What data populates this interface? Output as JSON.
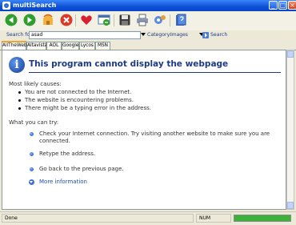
{
  "window": {
    "title": "multiSearch"
  },
  "toolbar": {
    "buttons": [
      "back-icon",
      "forward-icon",
      "home-icon",
      "stop-icon",
      "favorites-icon",
      "refresh-icon",
      "save-icon",
      "print-icon",
      "settings-icon",
      "help-icon"
    ]
  },
  "search": {
    "label": "Search for:",
    "value": "asad",
    "category_label": "Category:",
    "category_value": "Images",
    "search_button": "Search"
  },
  "tabs": [
    "AllTheWeb",
    "Altavista",
    "AOL",
    "Google",
    "Lycos",
    "MSN"
  ],
  "active_tab": "AllTheWeb",
  "error": {
    "title": "This program cannot display the webpage",
    "causes_heading": "Most likely causes:",
    "causes": [
      "You are not connected to the Internet.",
      "The website is encountering problems.",
      "There might be a typing error in the address."
    ],
    "try_heading": "What you can try:",
    "try_items": [
      "Check your Internet connection. Try visiting another website to make sure you are",
      "connected.",
      "Retype the address.",
      "Go back to the previous page."
    ],
    "more_info": "More information"
  },
  "status": {
    "text": "Done",
    "num": "NUM",
    "progress": 1.0
  },
  "colors": {
    "title_blue": "#1d3a8a",
    "titlebar": "#0d4fd6",
    "progress": "#3cb23c"
  }
}
